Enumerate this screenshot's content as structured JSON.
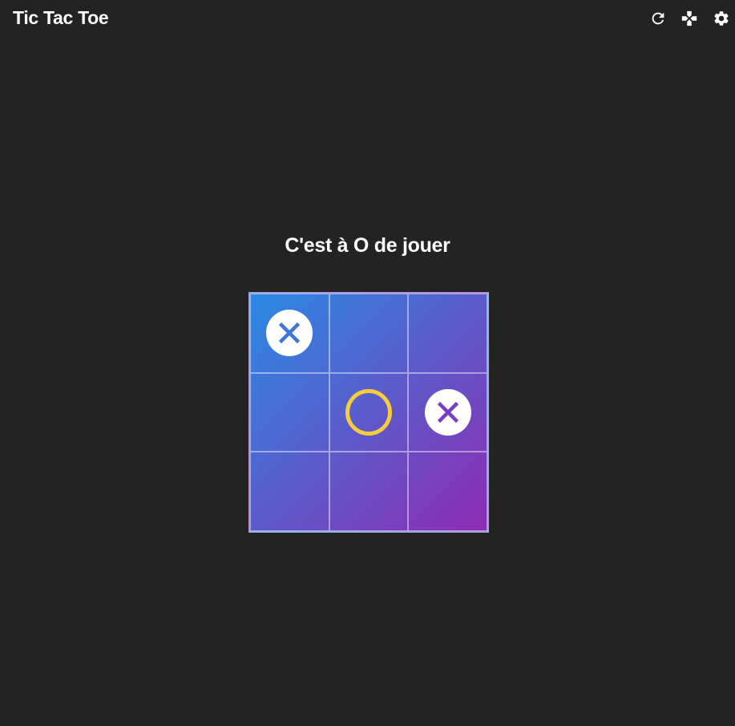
{
  "header": {
    "title": "Tic Tac Toe",
    "icons": [
      "refresh-icon",
      "gamepad-icon",
      "gear-icon"
    ]
  },
  "status_text": "C'est à O de jouer",
  "board": {
    "cells": [
      "X",
      "",
      "",
      "",
      "O",
      "X",
      "",
      "",
      ""
    ]
  },
  "colors": {
    "background": "#232323",
    "board_gradient_start": "#2a8ae4",
    "board_gradient_end": "#8e2bb2",
    "x_mark_bg": "#ffffff",
    "o_mark": "#f6cd3c"
  }
}
